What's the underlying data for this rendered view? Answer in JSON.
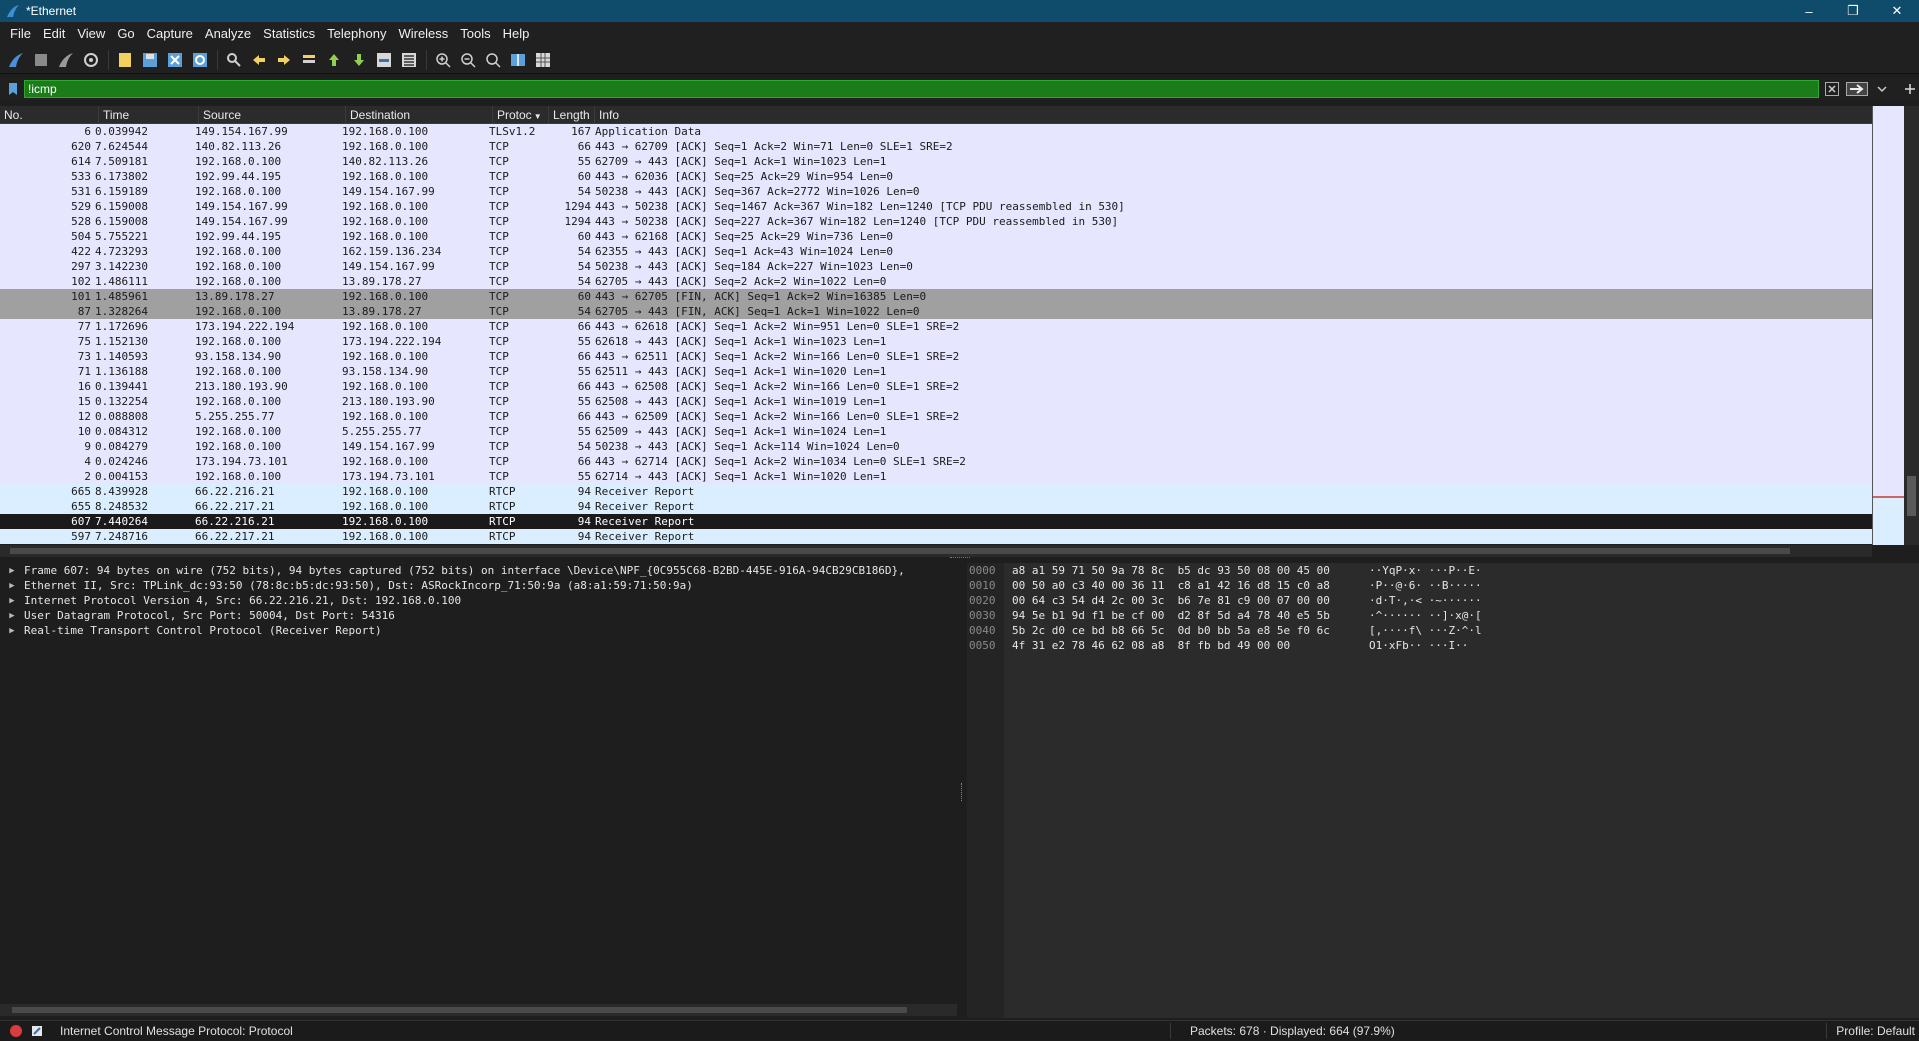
{
  "window": {
    "title": "*Ethernet",
    "controls": {
      "minimize": "–",
      "restore": "❐",
      "close": "✕"
    }
  },
  "menu": [
    "File",
    "Edit",
    "View",
    "Go",
    "Capture",
    "Analyze",
    "Statistics",
    "Telephony",
    "Wireless",
    "Tools",
    "Help"
  ],
  "toolbar": {
    "icons": [
      "shark-fin-start-icon",
      "stop-square-icon",
      "restart-shark-icon",
      "capture-options-icon",
      "open-file-icon",
      "save-file-icon",
      "close-file-icon",
      "reload-file-icon",
      "find-packet-icon",
      "go-back-icon",
      "go-forward-icon",
      "go-to-packet-icon",
      "go-first-icon",
      "go-last-icon",
      "autoscroll-icon",
      "colorize-icon",
      "zoom-in-icon",
      "zoom-out-icon",
      "normal-size-icon",
      "resize-columns-icon"
    ]
  },
  "filter": {
    "value": "!icmp",
    "bookmark_icon": "bookmark-icon",
    "clear_icon": "clear-x-icon",
    "apply_icon": "apply-arrow-icon",
    "dropdown_icon": "chevron-down-icon",
    "add_icon": "plus-icon",
    "valid_color": "#1a7d1a"
  },
  "packet_list": {
    "columns": [
      "No.",
      "Time",
      "Source",
      "Destination",
      "Protoc",
      "Length",
      "Info"
    ],
    "rows": [
      {
        "no": "6",
        "time": "0.039942",
        "src": "149.154.167.99",
        "dst": "192.168.0.100",
        "proto": "TLSv1.2",
        "len": "167",
        "info": "Application Data",
        "kind": "tls"
      },
      {
        "no": "620",
        "time": "7.624544",
        "src": "140.82.113.26",
        "dst": "192.168.0.100",
        "proto": "TCP",
        "len": "66",
        "info": "443 → 62709 [ACK] Seq=1 Ack=2 Win=71 Len=0 SLE=1 SRE=2",
        "kind": "tcp"
      },
      {
        "no": "614",
        "time": "7.509181",
        "src": "192.168.0.100",
        "dst": "140.82.113.26",
        "proto": "TCP",
        "len": "55",
        "info": "62709 → 443 [ACK] Seq=1 Ack=1 Win=1023 Len=1",
        "kind": "tcp"
      },
      {
        "no": "533",
        "time": "6.173802",
        "src": "192.99.44.195",
        "dst": "192.168.0.100",
        "proto": "TCP",
        "len": "60",
        "info": "443 → 62036 [ACK] Seq=25 Ack=29 Win=954 Len=0",
        "kind": "tcp"
      },
      {
        "no": "531",
        "time": "6.159189",
        "src": "192.168.0.100",
        "dst": "149.154.167.99",
        "proto": "TCP",
        "len": "54",
        "info": "50238 → 443 [ACK] Seq=367 Ack=2772 Win=1026 Len=0",
        "kind": "tcp"
      },
      {
        "no": "529",
        "time": "6.159008",
        "src": "149.154.167.99",
        "dst": "192.168.0.100",
        "proto": "TCP",
        "len": "1294",
        "info": "443 → 50238 [ACK] Seq=1467 Ack=367 Win=182 Len=1240 [TCP PDU reassembled in 530]",
        "kind": "tcp"
      },
      {
        "no": "528",
        "time": "6.159008",
        "src": "149.154.167.99",
        "dst": "192.168.0.100",
        "proto": "TCP",
        "len": "1294",
        "info": "443 → 50238 [ACK] Seq=227 Ack=367 Win=182 Len=1240 [TCP PDU reassembled in 530]",
        "kind": "tcp"
      },
      {
        "no": "504",
        "time": "5.755221",
        "src": "192.99.44.195",
        "dst": "192.168.0.100",
        "proto": "TCP",
        "len": "60",
        "info": "443 → 62168 [ACK] Seq=25 Ack=29 Win=736 Len=0",
        "kind": "tcp"
      },
      {
        "no": "422",
        "time": "4.723293",
        "src": "192.168.0.100",
        "dst": "162.159.136.234",
        "proto": "TCP",
        "len": "54",
        "info": "62355 → 443 [ACK] Seq=1 Ack=43 Win=1024 Len=0",
        "kind": "tcp"
      },
      {
        "no": "297",
        "time": "3.142230",
        "src": "192.168.0.100",
        "dst": "149.154.167.99",
        "proto": "TCP",
        "len": "54",
        "info": "50238 → 443 [ACK] Seq=184 Ack=227 Win=1023 Len=0",
        "kind": "tcp"
      },
      {
        "no": "102",
        "time": "1.486111",
        "src": "192.168.0.100",
        "dst": "13.89.178.27",
        "proto": "TCP",
        "len": "54",
        "info": "62705 → 443 [ACK] Seq=2 Ack=2 Win=1022 Len=0",
        "kind": "tcp"
      },
      {
        "no": "101",
        "time": "1.485961",
        "src": "13.89.178.27",
        "dst": "192.168.0.100",
        "proto": "TCP",
        "len": "60",
        "info": "443 → 62705 [FIN, ACK] Seq=1 Ack=2 Win=16385 Len=0",
        "kind": "fin"
      },
      {
        "no": "87",
        "time": "1.328264",
        "src": "192.168.0.100",
        "dst": "13.89.178.27",
        "proto": "TCP",
        "len": "54",
        "info": "62705 → 443 [FIN, ACK] Seq=1 Ack=1 Win=1022 Len=0",
        "kind": "fin"
      },
      {
        "no": "77",
        "time": "1.172696",
        "src": "173.194.222.194",
        "dst": "192.168.0.100",
        "proto": "TCP",
        "len": "66",
        "info": "443 → 62618 [ACK] Seq=1 Ack=2 Win=951 Len=0 SLE=1 SRE=2",
        "kind": "tcp"
      },
      {
        "no": "75",
        "time": "1.152130",
        "src": "192.168.0.100",
        "dst": "173.194.222.194",
        "proto": "TCP",
        "len": "55",
        "info": "62618 → 443 [ACK] Seq=1 Ack=1 Win=1023 Len=1",
        "kind": "tcp"
      },
      {
        "no": "73",
        "time": "1.140593",
        "src": "93.158.134.90",
        "dst": "192.168.0.100",
        "proto": "TCP",
        "len": "66",
        "info": "443 → 62511 [ACK] Seq=1 Ack=2 Win=166 Len=0 SLE=1 SRE=2",
        "kind": "tcp"
      },
      {
        "no": "71",
        "time": "1.136188",
        "src": "192.168.0.100",
        "dst": "93.158.134.90",
        "proto": "TCP",
        "len": "55",
        "info": "62511 → 443 [ACK] Seq=1 Ack=1 Win=1020 Len=1",
        "kind": "tcp"
      },
      {
        "no": "16",
        "time": "0.139441",
        "src": "213.180.193.90",
        "dst": "192.168.0.100",
        "proto": "TCP",
        "len": "66",
        "info": "443 → 62508 [ACK] Seq=1 Ack=2 Win=166 Len=0 SLE=1 SRE=2",
        "kind": "tcp"
      },
      {
        "no": "15",
        "time": "0.132254",
        "src": "192.168.0.100",
        "dst": "213.180.193.90",
        "proto": "TCP",
        "len": "55",
        "info": "62508 → 443 [ACK] Seq=1 Ack=1 Win=1019 Len=1",
        "kind": "tcp"
      },
      {
        "no": "12",
        "time": "0.088808",
        "src": "5.255.255.77",
        "dst": "192.168.0.100",
        "proto": "TCP",
        "len": "66",
        "info": "443 → 62509 [ACK] Seq=1 Ack=2 Win=166 Len=0 SLE=1 SRE=2",
        "kind": "tcp"
      },
      {
        "no": "10",
        "time": "0.084312",
        "src": "192.168.0.100",
        "dst": "5.255.255.77",
        "proto": "TCP",
        "len": "55",
        "info": "62509 → 443 [ACK] Seq=1 Ack=1 Win=1024 Len=1",
        "kind": "tcp"
      },
      {
        "no": "9",
        "time": "0.084279",
        "src": "192.168.0.100",
        "dst": "149.154.167.99",
        "proto": "TCP",
        "len": "54",
        "info": "50238 → 443 [ACK] Seq=1 Ack=114 Win=1024 Len=0",
        "kind": "tcp"
      },
      {
        "no": "4",
        "time": "0.024246",
        "src": "173.194.73.101",
        "dst": "192.168.0.100",
        "proto": "TCP",
        "len": "66",
        "info": "443 → 62714 [ACK] Seq=1 Ack=2 Win=1034 Len=0 SLE=1 SRE=2",
        "kind": "tcp"
      },
      {
        "no": "2",
        "time": "0.004153",
        "src": "192.168.0.100",
        "dst": "173.194.73.101",
        "proto": "TCP",
        "len": "55",
        "info": "62714 → 443 [ACK] Seq=1 Ack=1 Win=1020 Len=1",
        "kind": "tcp"
      },
      {
        "no": "665",
        "time": "8.439928",
        "src": "66.22.216.21",
        "dst": "192.168.0.100",
        "proto": "RTCP",
        "len": "94",
        "info": "Receiver Report",
        "kind": "rtcp"
      },
      {
        "no": "655",
        "time": "8.248532",
        "src": "66.22.217.21",
        "dst": "192.168.0.100",
        "proto": "RTCP",
        "len": "94",
        "info": "Receiver Report",
        "kind": "rtcp"
      },
      {
        "no": "607",
        "time": "7.440264",
        "src": "66.22.216.21",
        "dst": "192.168.0.100",
        "proto": "RTCP",
        "len": "94",
        "info": "Receiver Report",
        "kind": "sel"
      },
      {
        "no": "597",
        "time": "7.248716",
        "src": "66.22.217.21",
        "dst": "192.168.0.100",
        "proto": "RTCP",
        "len": "94",
        "info": "Receiver Report",
        "kind": "rtcp"
      }
    ]
  },
  "details": [
    "Frame 607: 94 bytes on wire (752 bits), 94 bytes captured (752 bits) on interface \\Device\\NPF_{0C955C68-B2BD-445E-916A-94CB29CB186D},",
    "Ethernet II, Src: TPLink_dc:93:50 (78:8c:b5:dc:93:50), Dst: ASRockIncorp_71:50:9a (a8:a1:59:71:50:9a)",
    "Internet Protocol Version 4, Src: 66.22.216.21, Dst: 192.168.0.100",
    "User Datagram Protocol, Src Port: 50004, Dst Port: 54316",
    "Real-time Transport Control Protocol (Receiver Report)"
  ],
  "bytes": [
    {
      "off": "0000",
      "hex": "a8 a1 59 71 50 9a 78 8c  b5 dc 93 50 08 00 45 00",
      "ascii": "··YqP·x· ···P··E·"
    },
    {
      "off": "0010",
      "hex": "00 50 a0 c3 40 00 36 11  c8 a1 42 16 d8 15 c0 a8",
      "ascii": "·P··@·6· ··B·····"
    },
    {
      "off": "0020",
      "hex": "00 64 c3 54 d4 2c 00 3c  b6 7e 81 c9 00 07 00 00",
      "ascii": "·d·T·,·< ·~······"
    },
    {
      "off": "0030",
      "hex": "94 5e b1 9d f1 be cf 00  d2 8f 5d a4 78 40 e5 5b",
      "ascii": "·^······ ··]·x@·["
    },
    {
      "off": "0040",
      "hex": "5b 2c d0 ce bd b8 66 5c  0d b0 bb 5a e8 5e f0 6c",
      "ascii": "[,····f\\ ···Z·^·l"
    },
    {
      "off": "0050",
      "hex": "4f 31 e2 78 46 62 08 a8  8f fb bd 49 00 00",
      "ascii": "O1·xFb·· ···I··"
    }
  ],
  "status": {
    "message": "Internet Control Message Protocol: Protocol",
    "packets": "Packets: 678 · Displayed: 664 (97.9%)",
    "profile": "Profile: Default"
  }
}
